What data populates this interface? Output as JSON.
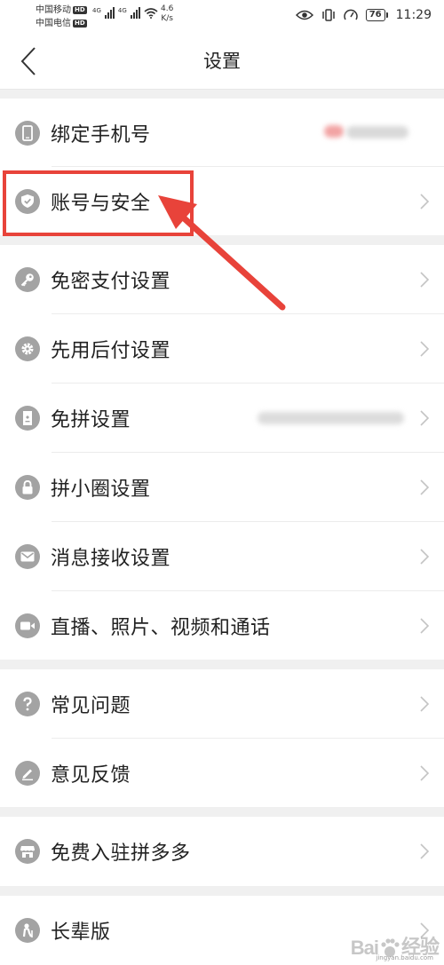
{
  "status_bar": {
    "carrier_1": "中国移动",
    "carrier_2": "中国电信",
    "hd_badge": "HD",
    "signal_label": "4G",
    "speed_value": "4.6",
    "speed_unit": "K/s",
    "battery": "76",
    "time": "11:29"
  },
  "header": {
    "title": "设置"
  },
  "settings_items": [
    {
      "label": "绑定手机号",
      "icon": "phone-icon"
    },
    {
      "label": "账号与安全",
      "icon": "shield-icon"
    },
    {
      "label": "免密支付设置",
      "icon": "key-icon"
    },
    {
      "label": "先用后付设置",
      "icon": "gear-icon"
    },
    {
      "label": "免拼设置",
      "icon": "card-icon"
    },
    {
      "label": "拼小圈设置",
      "icon": "lock-icon"
    },
    {
      "label": "消息接收设置",
      "icon": "mail-icon"
    },
    {
      "label": "直播、照片、视频和通话",
      "icon": "video-camera-icon"
    },
    {
      "label": "常见问题",
      "icon": "question-icon"
    },
    {
      "label": "意见反馈",
      "icon": "pencil-icon"
    },
    {
      "label": "免费入驻拼多多",
      "icon": "store-icon"
    },
    {
      "label": "长辈版",
      "icon": "elder-icon"
    }
  ],
  "annotation": {
    "color": "#e8433a",
    "highlighted_item": "账号与安全"
  },
  "watermark": {
    "text": "Bai",
    "text_2": "经验",
    "sub": "jingyan.baidu.com"
  },
  "colors": {
    "icon_gray": "#a3a3a3",
    "group_gap": "#f0f0f0",
    "chevron": "#c4c4c4"
  }
}
